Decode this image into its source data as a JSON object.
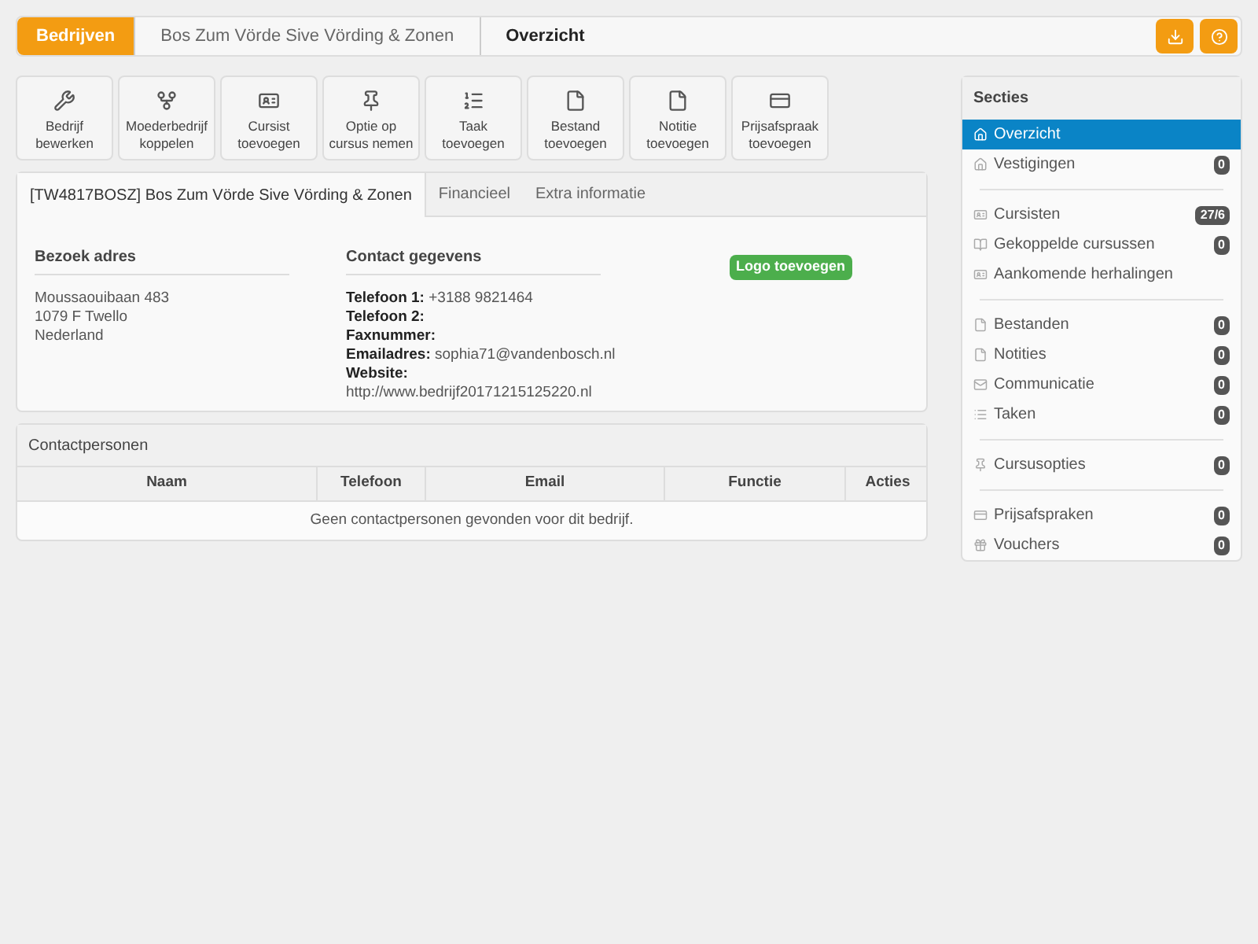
{
  "breadcrumb": [
    {
      "label": "Bedrijven",
      "selected": true
    },
    {
      "label": "Bos Zum Vörde Sive Vörding & Zonen",
      "selected": false
    },
    {
      "label": "Overzicht",
      "selected": false
    }
  ],
  "toolbar": [
    {
      "label": "Bedrijf bewerken"
    },
    {
      "label": "Moederbedrijf koppelen"
    },
    {
      "label": "Cursist toevoegen"
    },
    {
      "label": "Optie op cursus nemen"
    },
    {
      "label": "Taak toevoegen"
    },
    {
      "label": "Bestand toevoegen"
    },
    {
      "label": "Notitie toevoegen"
    },
    {
      "label": "Prijsafspraak toevoegen"
    }
  ],
  "tabs": [
    {
      "label": "[TW4817BOSZ] Bos Zum Vörde Sive Vörding & Zonen",
      "selected": true
    },
    {
      "label": "Financieel",
      "selected": false
    },
    {
      "label": "Extra informatie",
      "selected": false
    }
  ],
  "visit_address": {
    "heading": "Bezoek adres",
    "lines": [
      "Moussaouibaan 483",
      "1079 F Twello",
      "Nederland"
    ]
  },
  "contact": {
    "heading": "Contact gegevens",
    "fields": [
      {
        "label": "Telefoon 1:",
        "value": "+3188 9821464"
      },
      {
        "label": "Telefoon 2:"
      },
      {
        "label": "Faxnummer:"
      },
      {
        "label": "Emailadres:",
        "value": "sophia71@vandenbosch.nl"
      },
      {
        "label": "Website:",
        "value": "http://www.bedrijf20171215125220.nl",
        "below": true
      }
    ]
  },
  "logo_button": "Logo toevoegen",
  "contacts": {
    "title": "Contactpersonen",
    "columns": [
      "Naam",
      "Telefoon",
      "Email",
      "Functie",
      "Acties"
    ],
    "empty": "Geen contactpersonen gevonden voor dit bedrijf."
  },
  "sidebar": {
    "title": "Secties",
    "groups": [
      [
        {
          "label": "Overzicht",
          "selected": true
        },
        {
          "label": "Vestigingen",
          "count": "0",
          "selected": false
        }
      ],
      [
        {
          "label": "Cursisten",
          "count": "27/6",
          "selected": false
        },
        {
          "label": "Gekoppelde cursussen",
          "count": "0",
          "selected": false
        },
        {
          "label": "Aankomende herhalingen",
          "selected": false
        }
      ],
      [
        {
          "label": "Bestanden",
          "count": "0",
          "selected": false
        },
        {
          "label": "Notities",
          "count": "0",
          "selected": false
        },
        {
          "label": "Communicatie",
          "count": "0",
          "selected": false
        },
        {
          "label": "Taken",
          "count": "0",
          "selected": false
        }
      ],
      [
        {
          "label": "Cursusopties",
          "count": "0",
          "selected": false
        }
      ],
      [
        {
          "label": "Prijsafspraken",
          "count": "0",
          "selected": false
        },
        {
          "label": "Vouchers",
          "count": "0",
          "selected": false
        }
      ]
    ]
  }
}
